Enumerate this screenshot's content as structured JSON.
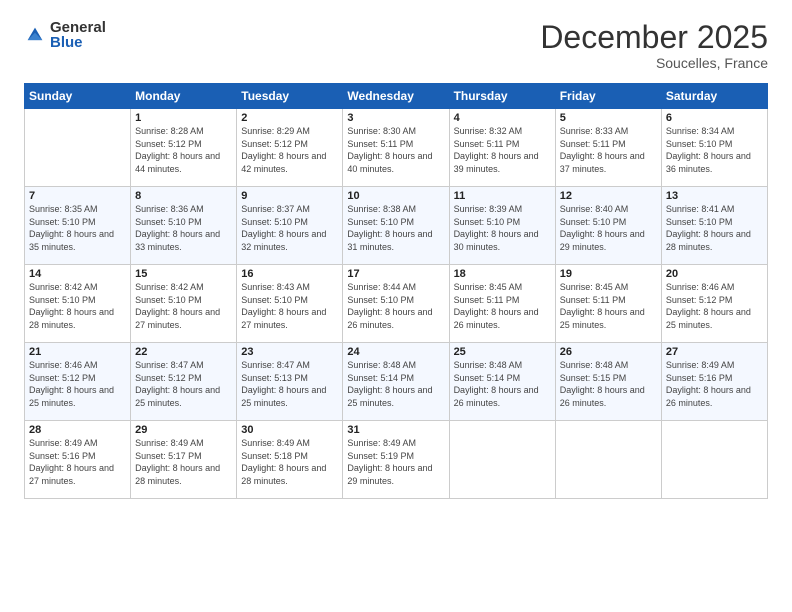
{
  "header": {
    "logo_general": "General",
    "logo_blue": "Blue",
    "month_title": "December 2025",
    "subtitle": "Soucelles, France"
  },
  "weekdays": [
    "Sunday",
    "Monday",
    "Tuesday",
    "Wednesday",
    "Thursday",
    "Friday",
    "Saturday"
  ],
  "weeks": [
    [
      {
        "day": "",
        "sunrise": "",
        "sunset": "",
        "daylight": ""
      },
      {
        "day": "1",
        "sunrise": "8:28 AM",
        "sunset": "5:12 PM",
        "daylight": "8 hours and 44 minutes."
      },
      {
        "day": "2",
        "sunrise": "8:29 AM",
        "sunset": "5:12 PM",
        "daylight": "8 hours and 42 minutes."
      },
      {
        "day": "3",
        "sunrise": "8:30 AM",
        "sunset": "5:11 PM",
        "daylight": "8 hours and 40 minutes."
      },
      {
        "day": "4",
        "sunrise": "8:32 AM",
        "sunset": "5:11 PM",
        "daylight": "8 hours and 39 minutes."
      },
      {
        "day": "5",
        "sunrise": "8:33 AM",
        "sunset": "5:11 PM",
        "daylight": "8 hours and 37 minutes."
      },
      {
        "day": "6",
        "sunrise": "8:34 AM",
        "sunset": "5:10 PM",
        "daylight": "8 hours and 36 minutes."
      }
    ],
    [
      {
        "day": "7",
        "sunrise": "8:35 AM",
        "sunset": "5:10 PM",
        "daylight": "8 hours and 35 minutes."
      },
      {
        "day": "8",
        "sunrise": "8:36 AM",
        "sunset": "5:10 PM",
        "daylight": "8 hours and 33 minutes."
      },
      {
        "day": "9",
        "sunrise": "8:37 AM",
        "sunset": "5:10 PM",
        "daylight": "8 hours and 32 minutes."
      },
      {
        "day": "10",
        "sunrise": "8:38 AM",
        "sunset": "5:10 PM",
        "daylight": "8 hours and 31 minutes."
      },
      {
        "day": "11",
        "sunrise": "8:39 AM",
        "sunset": "5:10 PM",
        "daylight": "8 hours and 30 minutes."
      },
      {
        "day": "12",
        "sunrise": "8:40 AM",
        "sunset": "5:10 PM",
        "daylight": "8 hours and 29 minutes."
      },
      {
        "day": "13",
        "sunrise": "8:41 AM",
        "sunset": "5:10 PM",
        "daylight": "8 hours and 28 minutes."
      }
    ],
    [
      {
        "day": "14",
        "sunrise": "8:42 AM",
        "sunset": "5:10 PM",
        "daylight": "8 hours and 28 minutes."
      },
      {
        "day": "15",
        "sunrise": "8:42 AM",
        "sunset": "5:10 PM",
        "daylight": "8 hours and 27 minutes."
      },
      {
        "day": "16",
        "sunrise": "8:43 AM",
        "sunset": "5:10 PM",
        "daylight": "8 hours and 27 minutes."
      },
      {
        "day": "17",
        "sunrise": "8:44 AM",
        "sunset": "5:10 PM",
        "daylight": "8 hours and 26 minutes."
      },
      {
        "day": "18",
        "sunrise": "8:45 AM",
        "sunset": "5:11 PM",
        "daylight": "8 hours and 26 minutes."
      },
      {
        "day": "19",
        "sunrise": "8:45 AM",
        "sunset": "5:11 PM",
        "daylight": "8 hours and 25 minutes."
      },
      {
        "day": "20",
        "sunrise": "8:46 AM",
        "sunset": "5:12 PM",
        "daylight": "8 hours and 25 minutes."
      }
    ],
    [
      {
        "day": "21",
        "sunrise": "8:46 AM",
        "sunset": "5:12 PM",
        "daylight": "8 hours and 25 minutes."
      },
      {
        "day": "22",
        "sunrise": "8:47 AM",
        "sunset": "5:12 PM",
        "daylight": "8 hours and 25 minutes."
      },
      {
        "day": "23",
        "sunrise": "8:47 AM",
        "sunset": "5:13 PM",
        "daylight": "8 hours and 25 minutes."
      },
      {
        "day": "24",
        "sunrise": "8:48 AM",
        "sunset": "5:14 PM",
        "daylight": "8 hours and 25 minutes."
      },
      {
        "day": "25",
        "sunrise": "8:48 AM",
        "sunset": "5:14 PM",
        "daylight": "8 hours and 26 minutes."
      },
      {
        "day": "26",
        "sunrise": "8:48 AM",
        "sunset": "5:15 PM",
        "daylight": "8 hours and 26 minutes."
      },
      {
        "day": "27",
        "sunrise": "8:49 AM",
        "sunset": "5:16 PM",
        "daylight": "8 hours and 26 minutes."
      }
    ],
    [
      {
        "day": "28",
        "sunrise": "8:49 AM",
        "sunset": "5:16 PM",
        "daylight": "8 hours and 27 minutes."
      },
      {
        "day": "29",
        "sunrise": "8:49 AM",
        "sunset": "5:17 PM",
        "daylight": "8 hours and 28 minutes."
      },
      {
        "day": "30",
        "sunrise": "8:49 AM",
        "sunset": "5:18 PM",
        "daylight": "8 hours and 28 minutes."
      },
      {
        "day": "31",
        "sunrise": "8:49 AM",
        "sunset": "5:19 PM",
        "daylight": "8 hours and 29 minutes."
      },
      {
        "day": "",
        "sunrise": "",
        "sunset": "",
        "daylight": ""
      },
      {
        "day": "",
        "sunrise": "",
        "sunset": "",
        "daylight": ""
      },
      {
        "day": "",
        "sunrise": "",
        "sunset": "",
        "daylight": ""
      }
    ]
  ],
  "labels": {
    "sunrise_prefix": "Sunrise: ",
    "sunset_prefix": "Sunset: ",
    "daylight_prefix": "Daylight: "
  }
}
